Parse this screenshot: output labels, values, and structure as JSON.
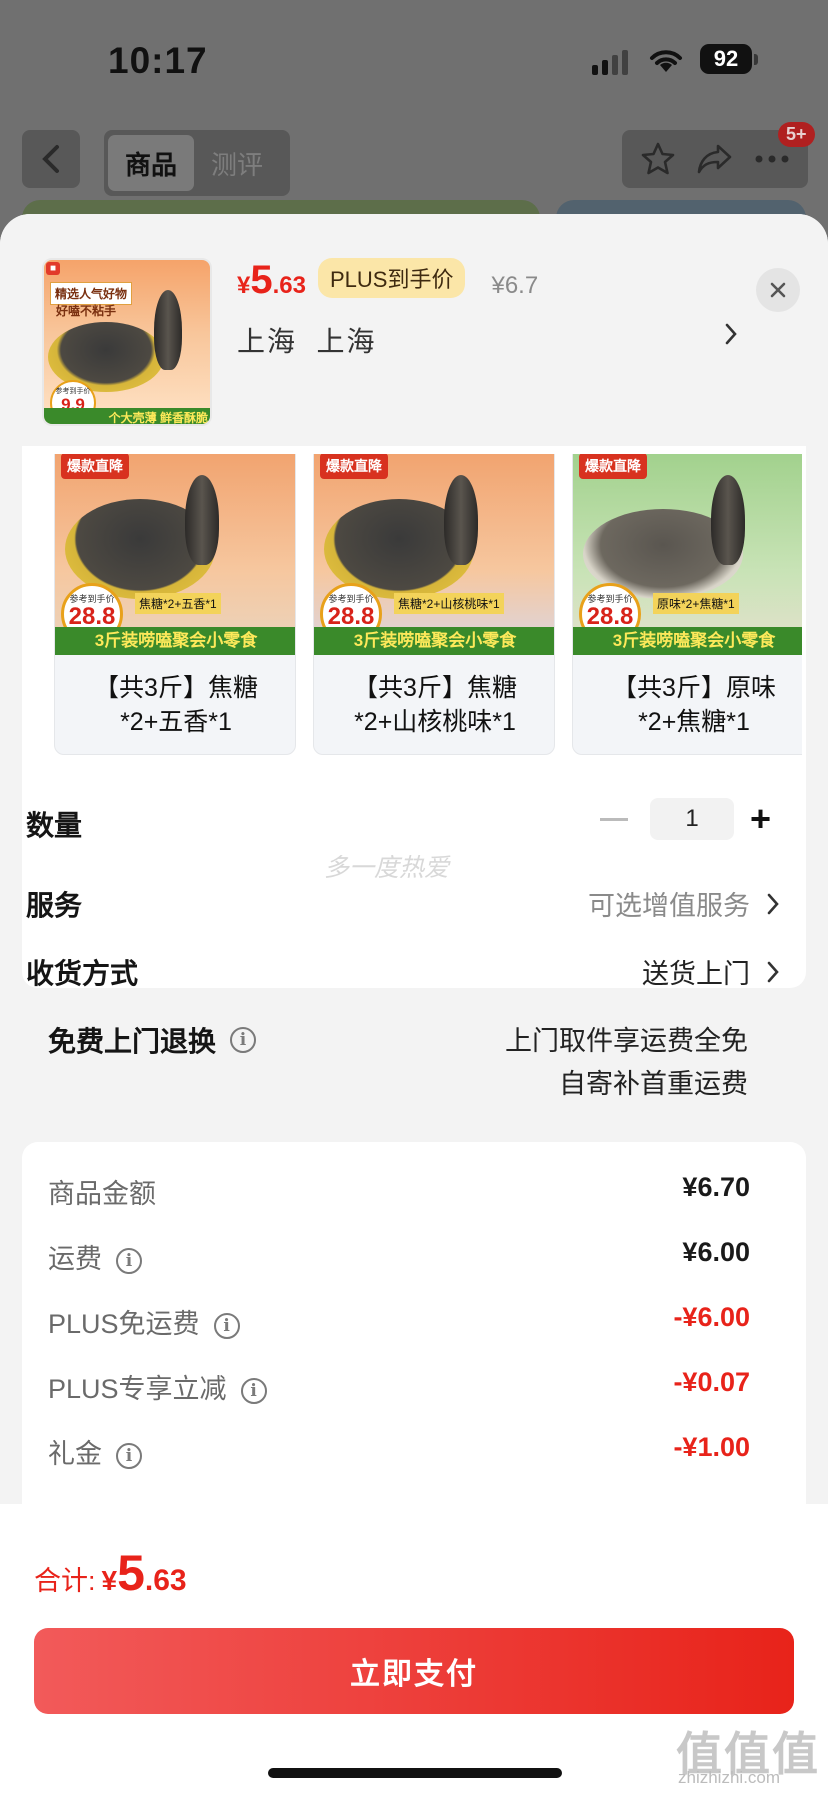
{
  "status_bar": {
    "time": "10:17",
    "battery": "92"
  },
  "nav": {
    "tabs": [
      {
        "label": "商品",
        "active": true
      },
      {
        "label": "测评",
        "active": false
      }
    ],
    "badge": "5+"
  },
  "product": {
    "price_currency": "¥",
    "price_int": "5",
    "price_dec": ".63",
    "plus_tag": "PLUS到手价",
    "original_price": "¥6.7",
    "address": "上海  上海",
    "thumb_texts": {
      "tag": "精选人气好物",
      "slogan": "好嗑不粘手",
      "ref_label": "参考到手价",
      "ref_price": "9.9",
      "bottom": "个大壳薄 鲜香酥脆"
    }
  },
  "variants": [
    {
      "label": "【共3斤】焦糖*2+五香*1",
      "badge": "爆款直降",
      "img_caption": "焦糖*2+五香*1",
      "ref_label": "参考到手价",
      "ref_price": "28.8",
      "banner": "3斤装唠嗑聚会小零食"
    },
    {
      "label": "【共3斤】焦糖*2+山核桃味*1",
      "badge": "爆款直降",
      "img_caption": "焦糖*2+山核桃味*1",
      "ref_label": "参考到手价",
      "ref_price": "28.8",
      "banner": "3斤装唠嗑聚会小零食"
    },
    {
      "label": "【共3斤】原味*2+焦糖*1",
      "badge": "爆款直降",
      "img_caption": "原味*2+焦糖*1",
      "ref_label": "参考到手价",
      "ref_price": "28.8",
      "banner": "3斤装唠嗑聚会小零食"
    }
  ],
  "options": {
    "quantity": {
      "label": "数量",
      "value": "1"
    },
    "service": {
      "label": "服务",
      "value": "可选增值服务"
    },
    "delivery": {
      "label": "收货方式",
      "value": "送货上门"
    },
    "return": {
      "label": "免费上门退换",
      "line1": "上门取件享运费全免",
      "line2": "自寄补首重运费"
    }
  },
  "watermark": "多一度热爱",
  "fees": [
    {
      "label": "商品金额",
      "value": "¥6.70",
      "info": false,
      "red": false
    },
    {
      "label": "运费",
      "value": "¥6.00",
      "info": true,
      "red": false
    },
    {
      "label": "PLUS免运费",
      "value": "-¥6.00",
      "info": true,
      "red": true
    },
    {
      "label": "PLUS专享立减",
      "value": "-¥0.07",
      "info": true,
      "red": true
    },
    {
      "label": "礼金",
      "value": "-¥1.00",
      "info": true,
      "red": true
    }
  ],
  "footer": {
    "total_label": "合计:",
    "total_currency": "¥",
    "total_int": "5",
    "total_dec": ".63",
    "pay_button": "立即支付"
  },
  "site_watermark": {
    "logo": "值值值",
    "url": "zhizhizhi.com"
  },
  "colors": {
    "accent": "#e8231a",
    "plus_tag_bg": "#fbe6a8"
  }
}
